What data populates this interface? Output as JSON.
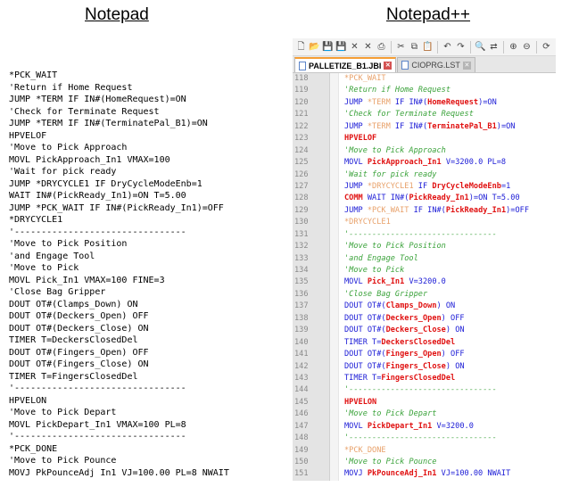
{
  "headings": {
    "left": "Notepad",
    "right": "Notepad++"
  },
  "notepad": {
    "lines": [
      "*PCK_WAIT",
      "'Return if Home Request",
      "JUMP *TERM IF IN#(HomeRequest)=ON",
      "'Check for Terminate Request",
      "JUMP *TERM IF IN#(TerminatePal_B1)=ON",
      "HPVELOF",
      "'Move to Pick Approach",
      "MOVL PickApproach_In1 VMAX=100",
      "'Wait for pick ready",
      "JUMP *DRYCYCLE1 IF DryCycleModeEnb=1",
      "WAIT IN#(PickReady_In1)=ON T=5.00",
      "JUMP *PCK_WAIT IF IN#(PickReady_In1)=OFF",
      "*DRYCYCLE1",
      "'--------------------------------",
      "'Move to Pick Position",
      "'and Engage Tool",
      "'Move to Pick",
      "MOVL Pick_In1 VMAX=100 FINE=3",
      "'Close Bag Gripper",
      "DOUT OT#(Clamps_Down) ON",
      "DOUT OT#(Deckers_Open) OFF",
      "DOUT OT#(Deckers_Close) ON",
      "TIMER T=DeckersClosedDel",
      "DOUT OT#(Fingers_Open) OFF",
      "DOUT OT#(Fingers_Close) ON",
      "TIMER T=FingersClosedDel",
      "'--------------------------------",
      "HPVELON",
      "'Move to Pick Depart",
      "MOVL PickDepart_In1 VMAX=100 PL=8",
      "'--------------------------------",
      "*PCK_DONE",
      "'Move to Pick Pounce",
      "MOVJ PkPounceAdj In1 VJ=100.00 PL=8 NWAIT"
    ]
  },
  "npp": {
    "colors": {
      "label": "#e8a16a",
      "comment": "#3aa23a",
      "keyword": "#1b1bd6",
      "bold_red": "#e01111",
      "tab_accent": "#f59e35"
    },
    "toolbar_icons": [
      "new-file-icon",
      "open-file-icon",
      "save-icon",
      "save-all-icon",
      "close-icon",
      "close-all-icon",
      "print-icon",
      "cut-icon",
      "copy-icon",
      "paste-icon",
      "undo-icon",
      "redo-icon",
      "find-icon",
      "replace-icon",
      "zoom-in-icon",
      "zoom-out-icon",
      "sync-icon"
    ],
    "tabs": [
      {
        "label": "PALLETIZE_B1.JBI",
        "active": true
      },
      {
        "label": "CIOPRG.LST",
        "active": false
      }
    ],
    "rows": [
      {
        "num": "118",
        "segs": [
          {
            "t": "*PCK_WAIT",
            "c": "c-label"
          }
        ]
      },
      {
        "num": "119",
        "segs": [
          {
            "t": "'Return if Home Request",
            "c": "c-comment"
          }
        ]
      },
      {
        "num": "120",
        "segs": [
          {
            "t": "JUMP ",
            "c": "c-keyword"
          },
          {
            "t": "*TERM",
            "c": "c-label"
          },
          {
            "t": " IF IN#(",
            "c": "c-keyword"
          },
          {
            "t": "HomeRequest",
            "c": "c-hpvel"
          },
          {
            "t": ")=ON",
            "c": "c-keyword"
          }
        ]
      },
      {
        "num": "121",
        "segs": [
          {
            "t": "'Check for Terminate Request",
            "c": "c-comment"
          }
        ]
      },
      {
        "num": "122",
        "segs": [
          {
            "t": "JUMP ",
            "c": "c-keyword"
          },
          {
            "t": "*TERM",
            "c": "c-label"
          },
          {
            "t": " IF IN#(",
            "c": "c-keyword"
          },
          {
            "t": "TerminatePal_B1",
            "c": "c-hpvel"
          },
          {
            "t": ")=ON",
            "c": "c-keyword"
          }
        ]
      },
      {
        "num": "123",
        "segs": [
          {
            "t": "HPVELOF",
            "c": "c-hpvel"
          }
        ]
      },
      {
        "num": "124",
        "segs": [
          {
            "t": "'Move to Pick Approach",
            "c": "c-comment"
          }
        ]
      },
      {
        "num": "125",
        "segs": [
          {
            "t": "MOVL ",
            "c": "c-keyword"
          },
          {
            "t": "PickApproach_In1",
            "c": "c-hpvel"
          },
          {
            "t": " V=3200.0 PL=8",
            "c": "c-keyword"
          }
        ]
      },
      {
        "num": "126",
        "segs": [
          {
            "t": "'Wait for pick ready",
            "c": "c-comment"
          }
        ]
      },
      {
        "num": "127",
        "segs": [
          {
            "t": "JUMP ",
            "c": "c-keyword"
          },
          {
            "t": "*DRYCYCLE1",
            "c": "c-label"
          },
          {
            "t": " IF ",
            "c": "c-keyword"
          },
          {
            "t": "DryCycleModeEnb",
            "c": "c-hpvel"
          },
          {
            "t": "=1",
            "c": "c-keyword"
          }
        ]
      },
      {
        "num": "128",
        "segs": [
          {
            "t": "COMM ",
            "c": "c-hpvel"
          },
          {
            "t": "WAIT IN#(",
            "c": "c-keyword"
          },
          {
            "t": "PickReady_In1",
            "c": "c-hpvel"
          },
          {
            "t": ")=ON T=5.00",
            "c": "c-keyword"
          }
        ]
      },
      {
        "num": "129",
        "segs": [
          {
            "t": "JUMP ",
            "c": "c-keyword"
          },
          {
            "t": "*PCK_WAIT",
            "c": "c-label"
          },
          {
            "t": " IF IN#(",
            "c": "c-keyword"
          },
          {
            "t": "PickReady_In1",
            "c": "c-hpvel"
          },
          {
            "t": ")=OFF",
            "c": "c-keyword"
          }
        ]
      },
      {
        "num": "130",
        "segs": [
          {
            "t": "*DRYCYCLE1",
            "c": "c-label"
          }
        ]
      },
      {
        "num": "131",
        "segs": [
          {
            "t": "'--------------------------------",
            "c": "c-comment"
          }
        ]
      },
      {
        "num": "132",
        "segs": [
          {
            "t": "'Move to Pick Position",
            "c": "c-comment"
          }
        ]
      },
      {
        "num": "133",
        "segs": [
          {
            "t": "'and Engage Tool",
            "c": "c-comment"
          }
        ]
      },
      {
        "num": "134",
        "segs": [
          {
            "t": "'Move to Pick",
            "c": "c-comment"
          }
        ]
      },
      {
        "num": "135",
        "segs": [
          {
            "t": "MOVL ",
            "c": "c-keyword"
          },
          {
            "t": "Pick_In1",
            "c": "c-hpvel"
          },
          {
            "t": " V=3200.0",
            "c": "c-keyword"
          }
        ]
      },
      {
        "num": "136",
        "segs": [
          {
            "t": "'Close Bag Gripper",
            "c": "c-comment"
          }
        ]
      },
      {
        "num": "137",
        "segs": [
          {
            "t": "DOUT OT#(",
            "c": "c-keyword"
          },
          {
            "t": "Clamps_Down",
            "c": "c-hpvel"
          },
          {
            "t": ") ON",
            "c": "c-keyword"
          }
        ]
      },
      {
        "num": "138",
        "segs": [
          {
            "t": "DOUT OT#(",
            "c": "c-keyword"
          },
          {
            "t": "Deckers_Open",
            "c": "c-hpvel"
          },
          {
            "t": ") OFF",
            "c": "c-keyword"
          }
        ]
      },
      {
        "num": "139",
        "segs": [
          {
            "t": "DOUT OT#(",
            "c": "c-keyword"
          },
          {
            "t": "Deckers_Close",
            "c": "c-hpvel"
          },
          {
            "t": ") ON",
            "c": "c-keyword"
          }
        ]
      },
      {
        "num": "140",
        "segs": [
          {
            "t": "TIMER T=",
            "c": "c-keyword"
          },
          {
            "t": "DeckersClosedDel",
            "c": "c-hpvel"
          }
        ]
      },
      {
        "num": "141",
        "segs": [
          {
            "t": "DOUT OT#(",
            "c": "c-keyword"
          },
          {
            "t": "Fingers_Open",
            "c": "c-hpvel"
          },
          {
            "t": ") OFF",
            "c": "c-keyword"
          }
        ]
      },
      {
        "num": "142",
        "segs": [
          {
            "t": "DOUT OT#(",
            "c": "c-keyword"
          },
          {
            "t": "Fingers_Close",
            "c": "c-hpvel"
          },
          {
            "t": ") ON",
            "c": "c-keyword"
          }
        ]
      },
      {
        "num": "143",
        "segs": [
          {
            "t": "TIMER T=",
            "c": "c-keyword"
          },
          {
            "t": "FingersClosedDel",
            "c": "c-hpvel"
          }
        ]
      },
      {
        "num": "144",
        "segs": [
          {
            "t": "'--------------------------------",
            "c": "c-comment"
          }
        ]
      },
      {
        "num": "145",
        "segs": [
          {
            "t": "HPVELON",
            "c": "c-hpvel"
          }
        ]
      },
      {
        "num": "146",
        "segs": [
          {
            "t": "'Move to Pick Depart",
            "c": "c-comment"
          }
        ]
      },
      {
        "num": "147",
        "segs": [
          {
            "t": "MOVL ",
            "c": "c-keyword"
          },
          {
            "t": "PickDepart_In1",
            "c": "c-hpvel"
          },
          {
            "t": " V=3200.0",
            "c": "c-keyword"
          }
        ]
      },
      {
        "num": "148",
        "segs": [
          {
            "t": "'--------------------------------",
            "c": "c-comment"
          }
        ]
      },
      {
        "num": "149",
        "segs": [
          {
            "t": "*PCK_DONE",
            "c": "c-label"
          }
        ]
      },
      {
        "num": "150",
        "segs": [
          {
            "t": "'Move to Pick Pounce",
            "c": "c-comment"
          }
        ]
      },
      {
        "num": "151",
        "segs": [
          {
            "t": "MOVJ ",
            "c": "c-keyword"
          },
          {
            "t": "PkPounceAdj_In1",
            "c": "c-hpvel"
          },
          {
            "t": " VJ=100.00 NWAIT",
            "c": "c-keyword"
          }
        ]
      }
    ]
  }
}
